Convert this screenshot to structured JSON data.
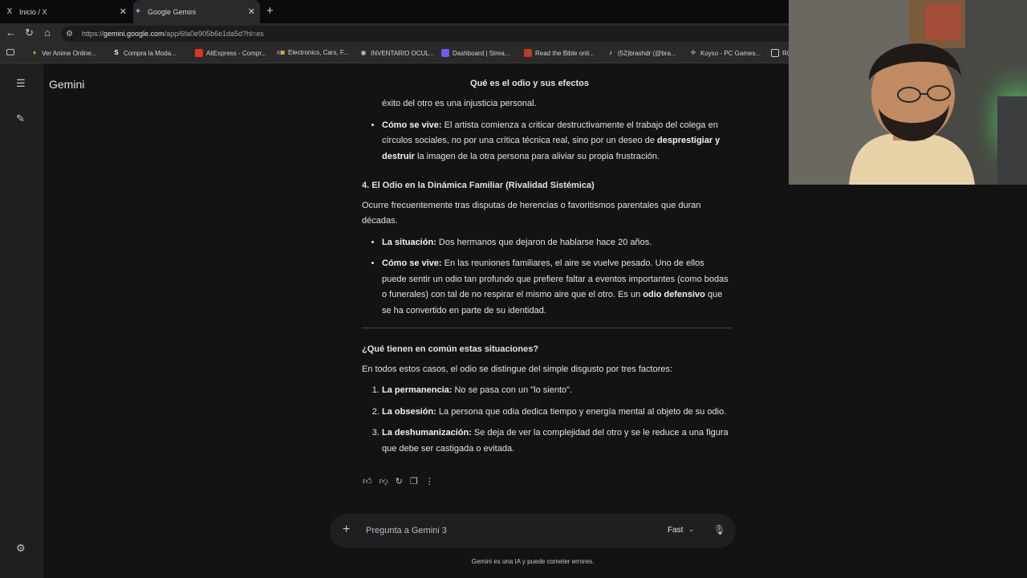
{
  "tabs": [
    {
      "icon": "x-logo-icon",
      "label": "Inicio / X"
    },
    {
      "icon": "gemini-spark-icon",
      "label": "Google Gemini"
    }
  ],
  "url": {
    "prefix": "https://",
    "host": "gemini.google.com",
    "path": "/app/6fa0e905b6e1da5d?hl=es"
  },
  "bookmarks": [
    "Ver Anime Online...",
    "Compra la Moda...",
    "AliExpress - Compr...",
    "Electronics, Cars, F...",
    "INVENTARIO OCUL...",
    "Dashboard | Strea...",
    "Read the Bible onli...",
    "(52)brashdr (@bra...",
    "Koyso - PC Games...",
    "RO"
  ],
  "app": {
    "name": "Gemini",
    "conversation_title": "Qué es el odio y sus efectos"
  },
  "response": {
    "partial_line": "éxito del otro es una injusticia personal.",
    "b3": {
      "label": "Cómo se vive:",
      "t1": " El artista comienza a criticar destructivamente el trabajo del colega en círculos sociales, no por una crítica técnica real, sino por un deseo de ",
      "bold": "desprestigiar y destruir",
      "t2": " la imagen de la otra persona para aliviar su propia frustración."
    },
    "s4": {
      "heading": "4. El Odio en la Dinámica Familiar (Rivalidad Sistémica)",
      "intro": "Ocurre frecuentemente tras disputas de herencias o favoritismos parentales que duran décadas.",
      "i1_label": "La situación:",
      "i1_text": " Dos hermanos que dejaron de hablarse hace 20 años.",
      "i2_label": "Cómo se vive:",
      "i2_t1": " En las reuniones familiares, el aire se vuelve pesado. Uno de ellos puede sentir un odio tan profundo que prefiere faltar a eventos importantes (como bodas o funerales) con tal de no respirar el mismo aire que el otro. Es un ",
      "i2_bold": "odio defensivo",
      "i2_t2": " que se ha convertido en parte de su identidad."
    },
    "common": {
      "heading": "¿Qué tienen en común estas situaciones?",
      "intro": "En todos estos casos, el odio se distingue del simple disgusto por tres factores:",
      "f1_label": "La permanencia:",
      "f1_text": " No se pasa con un \"lo siento\".",
      "f2_label": "La obsesión:",
      "f2_text": " La persona que odia dedica tiempo y energía mental al objeto de su odio.",
      "f3_label": "La deshumanización:",
      "f3_text": " Se deja de ver la complejidad del otro y se le reduce a una figura que debe ser castigada o evitada."
    }
  },
  "input": {
    "placeholder": "Pregunta a Gemini 3",
    "mode": "Fast"
  },
  "disclaimer": "Gemini es una IA y puede cometer errores.",
  "icons": [
    "menu-icon",
    "new-chat-icon",
    "settings-icon",
    "thumbs-up-icon",
    "thumbs-down-icon",
    "regenerate-icon",
    "copy-icon",
    "more-options-icon",
    "plus-icon",
    "chevron-down-icon",
    "microphone-icon"
  ],
  "colors": {
    "background": "#131314",
    "rail": "#1e1f20",
    "text": "#e3e3e3",
    "input": "#1e1f20"
  }
}
